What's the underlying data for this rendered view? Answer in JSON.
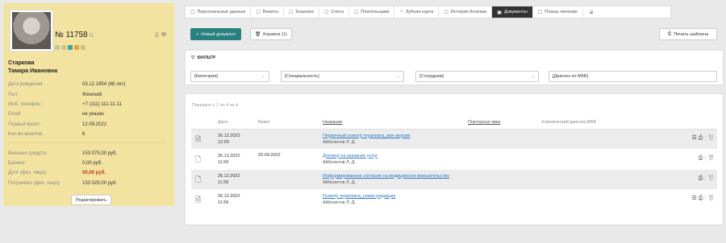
{
  "patient": {
    "number": "№ 11758",
    "number_suffix": "G",
    "name_line1": "Старкова",
    "name_line2": "Тамара Ивановна",
    "dot_colors": [
      "#c9c39a",
      "#c9c39a",
      "#3fa4a4",
      "#e8a33c",
      "#d6c07a"
    ],
    "fields": [
      {
        "label": "Дата рождения:",
        "value": "03.12.1954 (68 лет)"
      },
      {
        "label": "Пол:",
        "value": "Женский"
      },
      {
        "label": "Моб. телефон:",
        "value": "+7 (111) 111-11-11"
      },
      {
        "label": "Email:",
        "value": "не указан"
      },
      {
        "label": "Первый визит:",
        "value": "12.09.2022"
      },
      {
        "label": "Кол-во визитов:",
        "value": "6"
      }
    ],
    "finance": [
      {
        "label": "Внесено средств:",
        "value": "153 075,00 руб."
      },
      {
        "label": "Баланс:",
        "value": "0,00 руб."
      },
      {
        "label": "Долг (физ. лицо):",
        "value": "50,00 руб."
      },
      {
        "label": "Потрачено (физ. лицо):",
        "value": "153 025,00 руб."
      }
    ],
    "edit_label": "Редактировать"
  },
  "tabs": [
    {
      "icon": "☐",
      "label": "Персональные данные"
    },
    {
      "icon": "☐",
      "label": "Визиты"
    },
    {
      "icon": "☐",
      "label": "Кошелек"
    },
    {
      "icon": "☐",
      "label": "Счета"
    },
    {
      "icon": "☐",
      "label": "Плательщики"
    },
    {
      "icon": "♆",
      "label": "Зубная карта"
    },
    {
      "icon": "☐",
      "label": "История болезни"
    },
    {
      "icon": "▣",
      "label": "Документы"
    },
    {
      "icon": "☐",
      "label": "Планы лечения"
    }
  ],
  "toolbar": {
    "new_doc": "Новый документ",
    "trash": "Корзина (1)",
    "print_template": "Печать шаблона"
  },
  "filter": {
    "title": "ФИЛЬТР",
    "category": "[Категория]",
    "specialty": "[Специальность]",
    "employee": "[Сотрудник]",
    "diagnosis": "[Диагноз по МКБ]"
  },
  "table": {
    "shown": "Показано с 1 по 4 из 4",
    "headers": {
      "date": "Дата",
      "visit": "Визит",
      "name": "Название",
      "repeat": "Повторная явка",
      "diag": "Клинический диагноз МКБ"
    },
    "rows": [
      {
        "date": "26.12.2022",
        "time": "12:00",
        "visit": "",
        "title": "Первичный осмотр терапевта_мое версия",
        "author": "Айболитов Л. Д."
      },
      {
        "date": "26.12.2022",
        "time": "11:59",
        "visit": "20.09.2022",
        "title": "Договор на оказание услуг",
        "author": "Айболитов Л. Д."
      },
      {
        "date": "26.12.2022",
        "time": "11:59",
        "visit": "",
        "title": "Информированное согласие на медицинское вмешательство",
        "author": "Айболитов Л. Д."
      },
      {
        "date": "26.12.2022",
        "time": "11:59",
        "visit": "",
        "title": "Осмотр терапевта_новая редакция",
        "author": "Айболитов Л. Д."
      }
    ]
  }
}
